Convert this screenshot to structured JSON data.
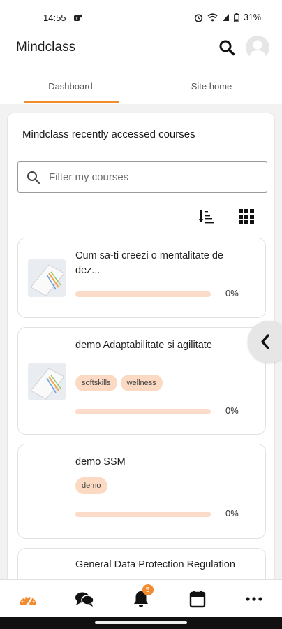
{
  "status_bar": {
    "time": "14:55",
    "battery": "31%"
  },
  "header": {
    "title": "Mindclass",
    "search_icon": "search-icon",
    "avatar_icon": "user-avatar-icon"
  },
  "tabs": [
    {
      "label": "Dashboard",
      "active": true
    },
    {
      "label": "Site home",
      "active": false
    }
  ],
  "block": {
    "title": "Mindclass recently accessed courses",
    "filter_placeholder": "Filter my courses",
    "sort_icon": "sort-icon",
    "view_icon": "grid-view-icon"
  },
  "courses": [
    {
      "name": "Cum sa-ti creezi o mentalitate de dez...",
      "tags": [],
      "progress_percent": 0,
      "progress_text": "0%",
      "has_image": true
    },
    {
      "name": "demo Adaptabilitate si agilitate",
      "tags": [
        "softskills",
        "wellness"
      ],
      "progress_percent": 0,
      "progress_text": "0%",
      "has_image": true
    },
    {
      "name": "demo SSM",
      "tags": [
        "demo"
      ],
      "progress_percent": 0,
      "progress_text": "0%",
      "has_image": false
    },
    {
      "name": "General Data Protection Regulation",
      "tags": [],
      "has_image": false
    }
  ],
  "drawer_toggle_icon": "chevron-left-icon",
  "bottom_nav": [
    {
      "icon": "dashboard-gauge-icon",
      "active": true
    },
    {
      "icon": "messages-icon",
      "active": false
    },
    {
      "icon": "notifications-bell-icon",
      "badge": "5",
      "active": false
    },
    {
      "icon": "calendar-icon",
      "active": false
    },
    {
      "icon": "more-icon",
      "active": false
    }
  ],
  "colors": {
    "accent": "#f28a30",
    "progress_track": "#fbdcc8",
    "tag_bg": "#fbd9c3"
  }
}
